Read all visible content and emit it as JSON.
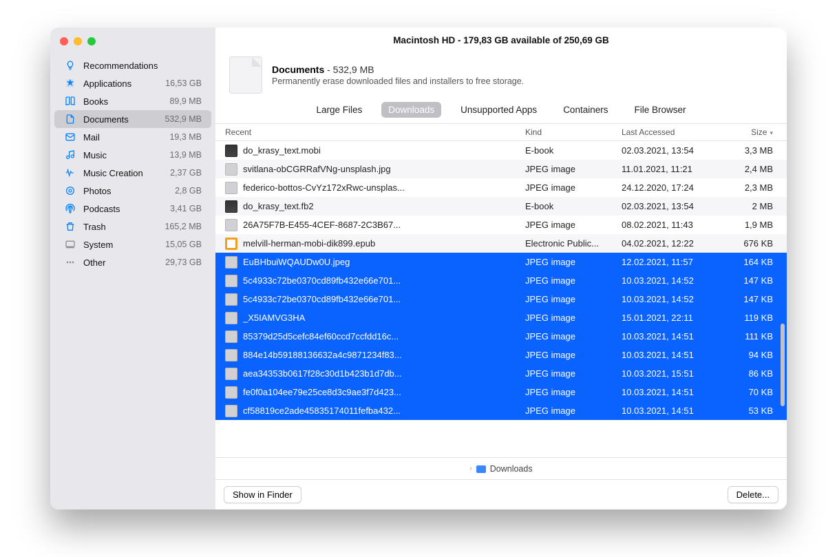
{
  "window_title": "Macintosh HD - 179,83 GB available of 250,69 GB",
  "sidebar": [
    {
      "icon": "lightbulb",
      "label": "Recommendations",
      "size": "",
      "selected": false,
      "color": "#0a84ff"
    },
    {
      "icon": "apps",
      "label": "Applications",
      "size": "16,53 GB",
      "selected": false,
      "color": "#0a84ff"
    },
    {
      "icon": "book",
      "label": "Books",
      "size": "89,9 MB",
      "selected": false,
      "color": "#0a84ff"
    },
    {
      "icon": "doc",
      "label": "Documents",
      "size": "532,9 MB",
      "selected": true,
      "color": "#0a84ff"
    },
    {
      "icon": "mail",
      "label": "Mail",
      "size": "19,3 MB",
      "selected": false,
      "color": "#0a84ff"
    },
    {
      "icon": "music",
      "label": "Music",
      "size": "13,9 MB",
      "selected": false,
      "color": "#0a84ff"
    },
    {
      "icon": "wave",
      "label": "Music Creation",
      "size": "2,37 GB",
      "selected": false,
      "color": "#0a84ff"
    },
    {
      "icon": "photo",
      "label": "Photos",
      "size": "2,8 GB",
      "selected": false,
      "color": "#0a84ff"
    },
    {
      "icon": "podcast",
      "label": "Podcasts",
      "size": "3,41 GB",
      "selected": false,
      "color": "#0a84ff"
    },
    {
      "icon": "trash",
      "label": "Trash",
      "size": "165,2 MB",
      "selected": false,
      "color": "#0a84ff"
    },
    {
      "icon": "system",
      "label": "System",
      "size": "15,05 GB",
      "selected": false,
      "color": "#8e8e93"
    },
    {
      "icon": "other",
      "label": "Other",
      "size": "29,73 GB",
      "selected": false,
      "color": "#8e8e93"
    }
  ],
  "header": {
    "title_bold": "Documents",
    "title_tail": " - 532,9 MB",
    "subtitle": "Permanently erase downloaded files and installers to free storage."
  },
  "segments": [
    {
      "label": "Large Files",
      "active": false
    },
    {
      "label": "Downloads",
      "active": true
    },
    {
      "label": "Unsupported Apps",
      "active": false
    },
    {
      "label": "Containers",
      "active": false
    },
    {
      "label": "File Browser",
      "active": false
    }
  ],
  "columns": {
    "name": "Recent",
    "kind": "Kind",
    "date": "Last Accessed",
    "size": "Size"
  },
  "files": [
    {
      "icon": "book",
      "name": "do_krasy_text.mobi",
      "kind": "E-book",
      "date": "02.03.2021, 13:54",
      "size": "3,3 MB",
      "sel": false
    },
    {
      "icon": "img",
      "name": "svitlana-obCGRRafVNg-unsplash.jpg",
      "kind": "JPEG image",
      "date": "11.01.2021, 11:21",
      "size": "2,4 MB",
      "sel": false
    },
    {
      "icon": "img",
      "name": "federico-bottos-CvYz172xRwc-unsplas...",
      "kind": "JPEG image",
      "date": "24.12.2020, 17:24",
      "size": "2,3 MB",
      "sel": false
    },
    {
      "icon": "book",
      "name": "do_krasy_text.fb2",
      "kind": "E-book",
      "date": "02.03.2021, 13:54",
      "size": "2 MB",
      "sel": false
    },
    {
      "icon": "img",
      "name": "26A75F7B-E455-4CEF-8687-2C3B67...",
      "kind": "JPEG image",
      "date": "08.02.2021, 11:43",
      "size": "1,9 MB",
      "sel": false
    },
    {
      "icon": "epub",
      "name": "melvill-herman-mobi-dik899.epub",
      "kind": "Electronic Public...",
      "date": "04.02.2021, 12:22",
      "size": "676 KB",
      "sel": false
    },
    {
      "icon": "img",
      "name": "EuBHbuiWQAUDw0U.jpeg",
      "kind": "JPEG image",
      "date": "12.02.2021, 11:57",
      "size": "164 KB",
      "sel": true
    },
    {
      "icon": "img",
      "name": "5c4933c72be0370cd89fb432e66e701...",
      "kind": "JPEG image",
      "date": "10.03.2021, 14:52",
      "size": "147 KB",
      "sel": true
    },
    {
      "icon": "img",
      "name": "5c4933c72be0370cd89fb432e66e701...",
      "kind": "JPEG image",
      "date": "10.03.2021, 14:52",
      "size": "147 KB",
      "sel": true
    },
    {
      "icon": "img",
      "name": "_X5IAMVG3HA",
      "kind": "JPEG image",
      "date": "15.01.2021, 22:11",
      "size": "119 KB",
      "sel": true
    },
    {
      "icon": "img",
      "name": "85379d25d5cefc84ef60ccd7ccfdd16c...",
      "kind": "JPEG image",
      "date": "10.03.2021, 14:51",
      "size": "111 KB",
      "sel": true
    },
    {
      "icon": "img",
      "name": "884e14b59188136632a4c9871234f83...",
      "kind": "JPEG image",
      "date": "10.03.2021, 14:51",
      "size": "94 KB",
      "sel": true
    },
    {
      "icon": "img",
      "name": "aea34353b0617f28c30d1b423b1d7db...",
      "kind": "JPEG image",
      "date": "10.03.2021, 15:51",
      "size": "86 KB",
      "sel": true
    },
    {
      "icon": "img",
      "name": "fe0f0a104ee79e25ce8d3c9ae3f7d423...",
      "kind": "JPEG image",
      "date": "10.03.2021, 14:51",
      "size": "70 KB",
      "sel": true
    },
    {
      "icon": "img",
      "name": "cf58819ce2ade45835174011fefba432...",
      "kind": "JPEG image",
      "date": "10.03.2021, 14:51",
      "size": "53 KB",
      "sel": true
    }
  ],
  "path": "Downloads",
  "footer": {
    "show": "Show in Finder",
    "delete": "Delete..."
  }
}
